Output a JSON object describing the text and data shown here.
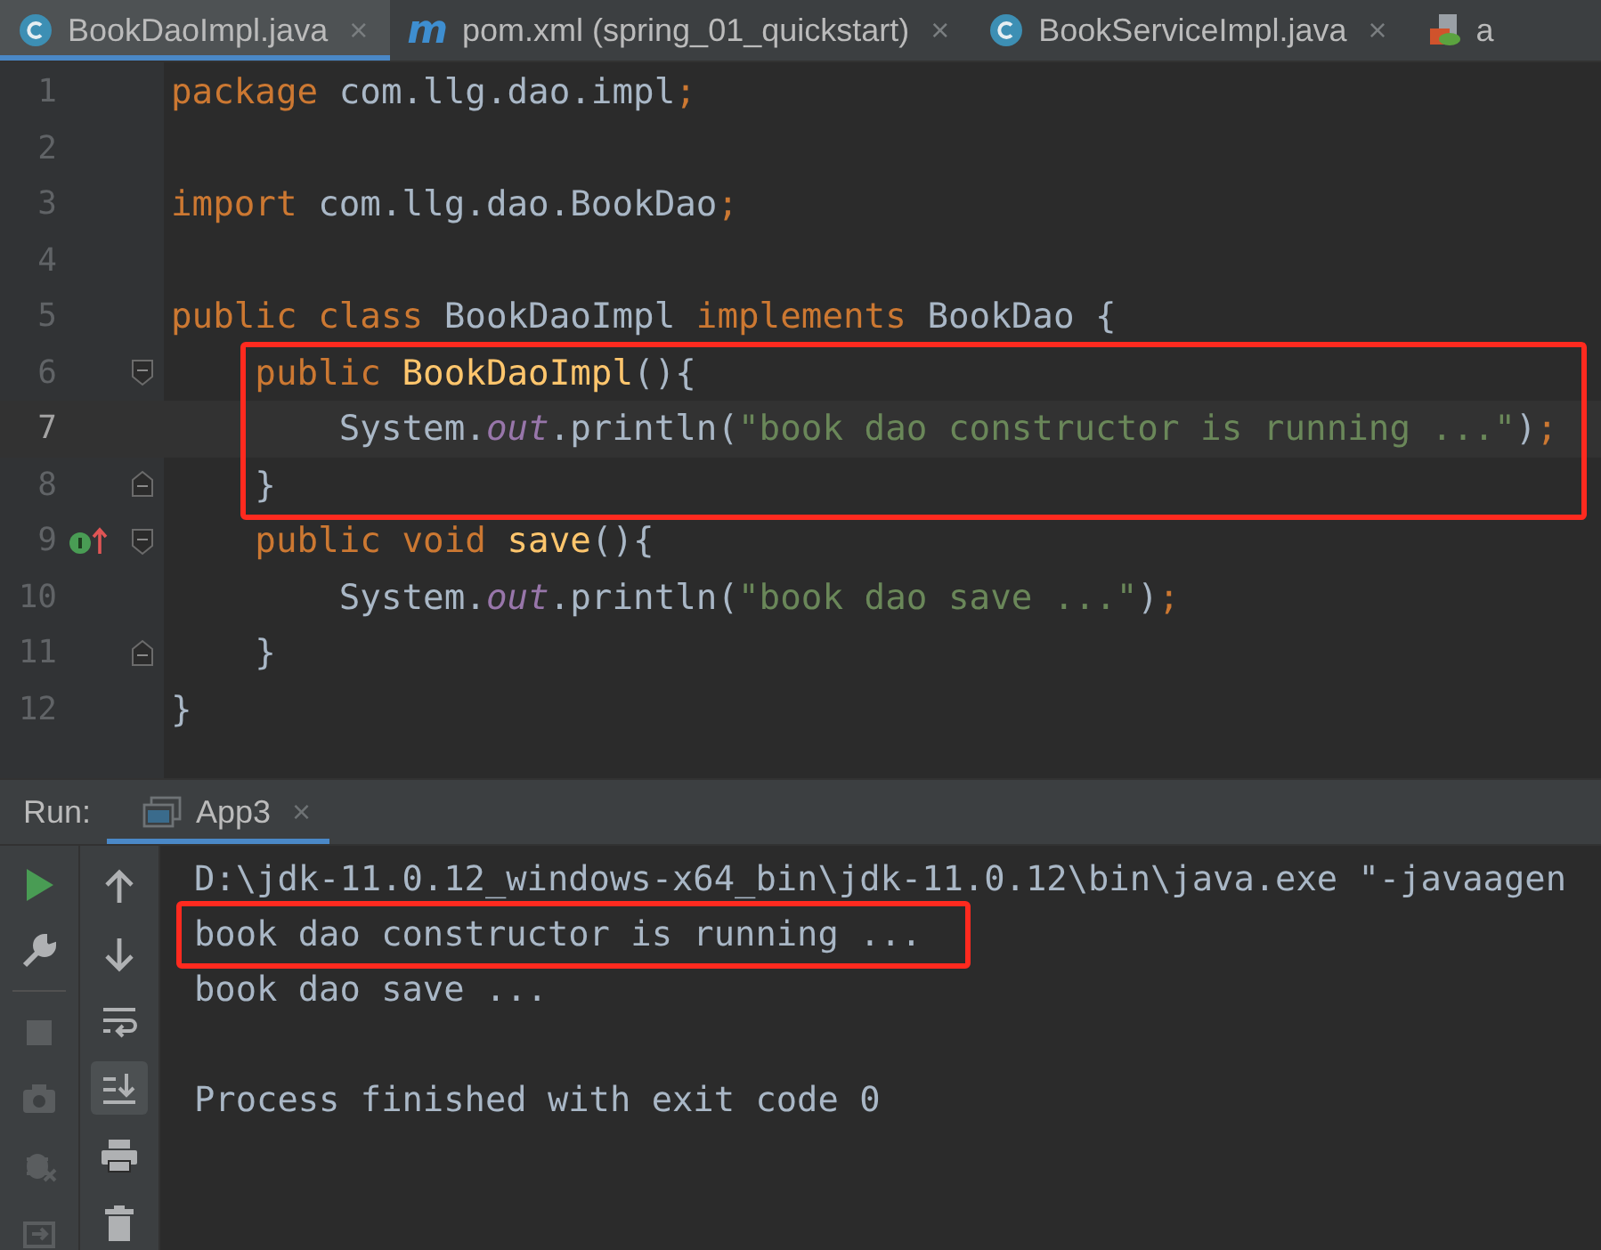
{
  "tabs": [
    {
      "label": "BookDaoImpl.java",
      "kind": "class",
      "close": "×",
      "selected": true
    },
    {
      "label": "pom.xml (spring_01_quickstart)",
      "kind": "maven",
      "badge": "m",
      "close": "×",
      "selected": false
    },
    {
      "label": "BookServiceImpl.java",
      "kind": "class",
      "close": "×",
      "selected": false
    },
    {
      "label": "a",
      "kind": "config",
      "selected": false
    }
  ],
  "editor": {
    "lines": [
      {
        "number": "1",
        "tokens": [
          {
            "text": "package",
            "kind": "keyword"
          },
          {
            "text": " com.llg.dao.impl",
            "kind": "plain"
          },
          {
            "text": ";",
            "kind": "keyword"
          }
        ]
      },
      {
        "number": "2"
      },
      {
        "number": "3",
        "tokens": [
          {
            "text": "import",
            "kind": "keyword"
          },
          {
            "text": " com.llg.dao.BookDao",
            "kind": "plain"
          },
          {
            "text": ";",
            "kind": "keyword"
          }
        ]
      },
      {
        "number": "4"
      },
      {
        "number": "5",
        "tokens": [
          {
            "text": "public class ",
            "kind": "keyword"
          },
          {
            "text": "BookDaoImpl ",
            "kind": "plain"
          },
          {
            "text": "implements ",
            "kind": "keyword"
          },
          {
            "text": "BookDao {",
            "kind": "plain"
          }
        ]
      },
      {
        "number": "6",
        "fold_start": true,
        "boxed": true,
        "tokens": [
          {
            "text": "    public ",
            "kind": "keyword"
          },
          {
            "text": "BookDaoImpl",
            "kind": "method"
          },
          {
            "text": "(){",
            "kind": "plain"
          }
        ]
      },
      {
        "number": "7",
        "current": true,
        "boxed": true,
        "tokens": [
          {
            "text": "        System.",
            "kind": "plain"
          },
          {
            "text": "out",
            "kind": "field"
          },
          {
            "text": ".println(",
            "kind": "plain"
          },
          {
            "text": "\"book dao constructor is running ...\"",
            "kind": "string"
          },
          {
            "text": ")",
            "kind": "plain"
          },
          {
            "text": ";",
            "kind": "keyword"
          }
        ]
      },
      {
        "number": "8",
        "fold_end": true,
        "boxed": true,
        "tokens": [
          {
            "text": "    }",
            "kind": "plain"
          }
        ]
      },
      {
        "number": "9",
        "fold_start": true,
        "implements_marker": true,
        "tokens": [
          {
            "text": "    public void ",
            "kind": "keyword"
          },
          {
            "text": "save",
            "kind": "method"
          },
          {
            "text": "(){",
            "kind": "plain"
          }
        ]
      },
      {
        "number": "10",
        "tokens": [
          {
            "text": "        System.",
            "kind": "plain"
          },
          {
            "text": "out",
            "kind": "field"
          },
          {
            "text": ".println(",
            "kind": "plain"
          },
          {
            "text": "\"book dao save ...\"",
            "kind": "string"
          },
          {
            "text": ")",
            "kind": "plain"
          },
          {
            "text": ";",
            "kind": "keyword"
          }
        ]
      },
      {
        "number": "11",
        "fold_end": true,
        "tokens": [
          {
            "text": "    }",
            "kind": "plain"
          }
        ]
      },
      {
        "number": "12",
        "tokens": [
          {
            "text": "}",
            "kind": "plain"
          }
        ]
      }
    ]
  },
  "run_panel": {
    "label": "Run:",
    "tabs": [
      {
        "label": "App3",
        "close": "×",
        "selected": true
      }
    ],
    "toolbar_left": [
      {
        "kind": "run",
        "disabled": false
      },
      {
        "kind": "wrench",
        "disabled": false
      },
      {
        "kind": "separator"
      },
      {
        "kind": "stop",
        "disabled": true
      },
      {
        "kind": "camera",
        "disabled": true
      },
      {
        "kind": "bug",
        "disabled": true
      },
      {
        "kind": "restore",
        "disabled": true
      }
    ],
    "toolbar_right": [
      {
        "kind": "up",
        "selected": false
      },
      {
        "kind": "down",
        "selected": false
      },
      {
        "kind": "wrap",
        "selected": false
      },
      {
        "kind": "scroll-end",
        "selected": true
      },
      {
        "kind": "print",
        "selected": false
      },
      {
        "kind": "trash",
        "selected": false
      }
    ],
    "console": [
      {
        "text": "D:\\jdk-11.0.12_windows-x64_bin\\jdk-11.0.12\\bin\\java.exe \"-javaagen"
      },
      {
        "text": "book dao constructor is running ...",
        "boxed": true
      },
      {
        "text": "book dao save ..."
      },
      {
        "text": "Process finished with exit code 0",
        "gap_before": true
      }
    ]
  }
}
